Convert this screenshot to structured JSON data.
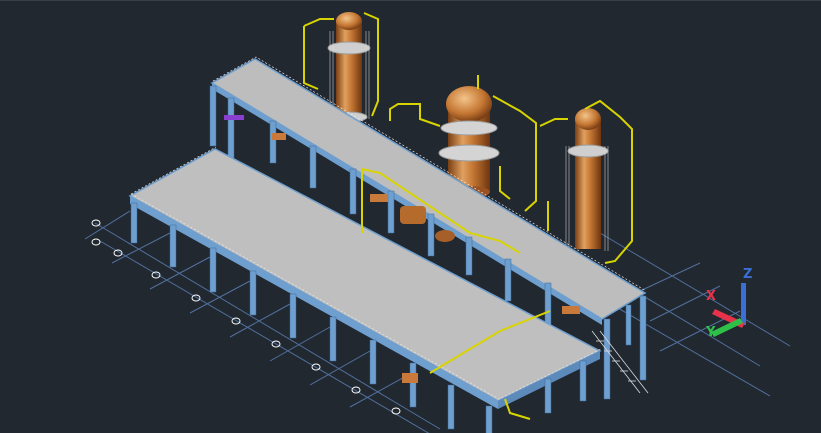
{
  "viewport": {
    "background": "#212830",
    "grid_color": "#5d82b8",
    "steel_color": "#6f9fce",
    "deck_color": "#b9b9b9",
    "pipe_color": "#d8d400",
    "vessel_color": "#c97a3a"
  },
  "ucs_icon": {
    "x_label": "X",
    "y_label": "Y",
    "z_label": "Z",
    "x_color": "#e8324a",
    "y_color": "#2fc04a",
    "z_color": "#3b6fd8"
  }
}
